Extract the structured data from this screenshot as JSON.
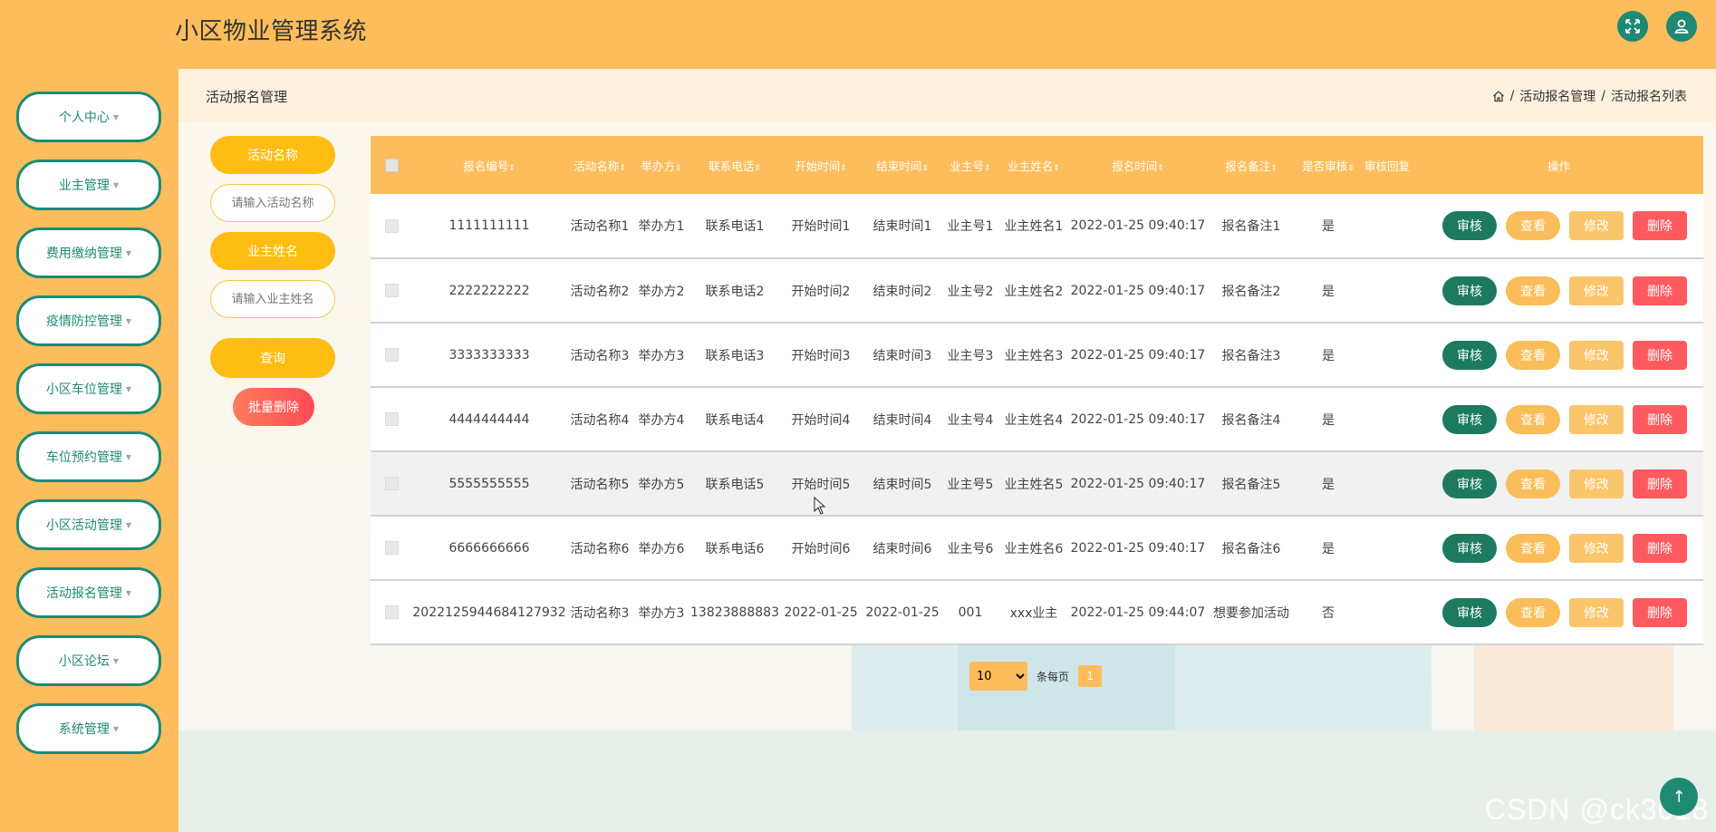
{
  "header": {
    "title": "小区物业管理系统"
  },
  "sidebar": {
    "items": [
      {
        "label": "个人中心"
      },
      {
        "label": "业主管理"
      },
      {
        "label": "费用缴纳管理"
      },
      {
        "label": "疫情防控管理"
      },
      {
        "label": "小区车位管理"
      },
      {
        "label": "车位预约管理"
      },
      {
        "label": "小区活动管理"
      },
      {
        "label": "活动报名管理"
      },
      {
        "label": "小区论坛"
      },
      {
        "label": "系统管理"
      }
    ]
  },
  "page": {
    "title": "活动报名管理",
    "breadcrumb": [
      "活动报名管理",
      "活动报名列表"
    ],
    "breadcrumb_sep": "/"
  },
  "filters": {
    "activity_label": "活动名称",
    "activity_placeholder": "请输入活动名称",
    "owner_label": "业主姓名",
    "owner_placeholder": "请输入业主姓名",
    "query_button": "查询",
    "batch_delete_button": "批量删除"
  },
  "table": {
    "columns": [
      "报名编号",
      "活动名称",
      "举办方",
      "联系电话",
      "开始时间",
      "结束时间",
      "业主号",
      "业主姓名",
      "报名时间",
      "报名备注",
      "是否审核",
      "审核回复",
      "操作"
    ],
    "sort_mark": "⇕",
    "rows": [
      [
        "1111111111",
        "活动名称1",
        "举办方1",
        "联系电话1",
        "开始时间1",
        "结束时间1",
        "业主号1",
        "业主姓名1",
        "2022-01-25 09:40:17",
        "报名备注1",
        "是",
        ""
      ],
      [
        "2222222222",
        "活动名称2",
        "举办方2",
        "联系电话2",
        "开始时间2",
        "结束时间2",
        "业主号2",
        "业主姓名2",
        "2022-01-25 09:40:17",
        "报名备注2",
        "是",
        ""
      ],
      [
        "3333333333",
        "活动名称3",
        "举办方3",
        "联系电话3",
        "开始时间3",
        "结束时间3",
        "业主号3",
        "业主姓名3",
        "2022-01-25 09:40:17",
        "报名备注3",
        "是",
        ""
      ],
      [
        "4444444444",
        "活动名称4",
        "举办方4",
        "联系电话4",
        "开始时间4",
        "结束时间4",
        "业主号4",
        "业主姓名4",
        "2022-01-25 09:40:17",
        "报名备注4",
        "是",
        ""
      ],
      [
        "5555555555",
        "活动名称5",
        "举办方5",
        "联系电话5",
        "开始时间5",
        "结束时间5",
        "业主号5",
        "业主姓名5",
        "2022-01-25 09:40:17",
        "报名备注5",
        "是",
        ""
      ],
      [
        "6666666666",
        "活动名称6",
        "举办方6",
        "联系电话6",
        "开始时间6",
        "结束时间6",
        "业主号6",
        "业主姓名6",
        "2022-01-25 09:40:17",
        "报名备注6",
        "是",
        ""
      ],
      [
        "2022125944684127932",
        "活动名称3",
        "举办方3",
        "13823888883",
        "2022-01-25",
        "2022-01-25",
        "001",
        "xxx业主",
        "2022-01-25 09:44:07",
        "想要参加活动",
        "否",
        ""
      ]
    ],
    "actions": {
      "audit": "审核",
      "view": "查看",
      "edit": "修改",
      "delete": "删除"
    },
    "highlighted_row": 4
  },
  "pagination": {
    "page_size": "10",
    "per_page_label": "条每页",
    "current_page": "1"
  },
  "watermark": "CSDN @ck3018",
  "colors": {
    "primary": "#fdbd5c",
    "accent": "#1e8a73",
    "danger": "#ff5a5f"
  },
  "icons": [
    "expand-icon",
    "user-icon",
    "home-icon",
    "arrow-up-icon"
  ]
}
